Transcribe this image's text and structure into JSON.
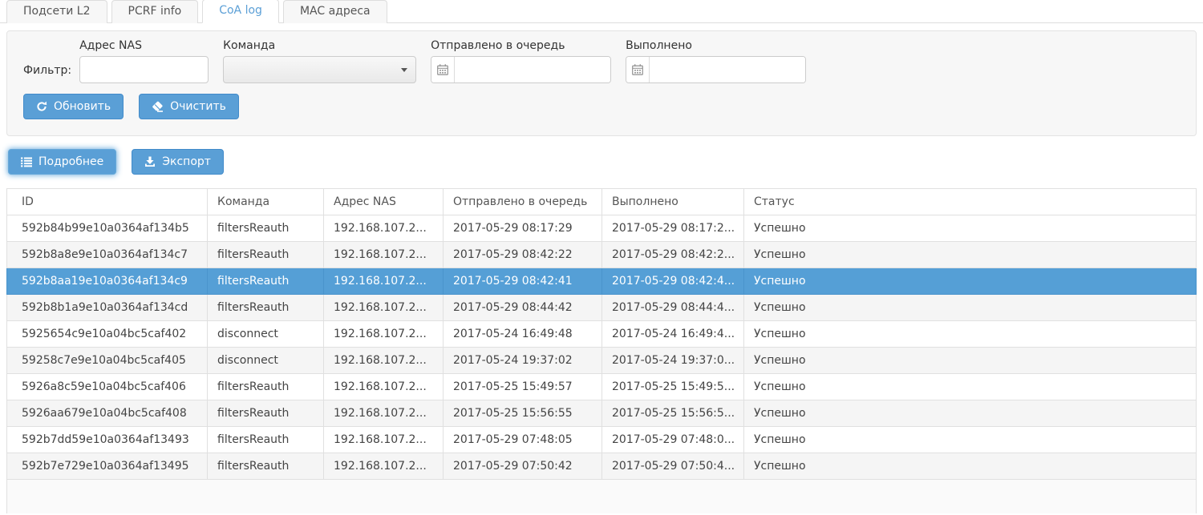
{
  "tabs": [
    {
      "label": "Подсети L2",
      "active": false
    },
    {
      "label": "PCRF info",
      "active": false
    },
    {
      "label": "CoA log",
      "active": true
    },
    {
      "label": "MAC адреса",
      "active": false
    }
  ],
  "filter": {
    "legend": "Фильтр:",
    "nas_label": "Адрес NAS",
    "nas_value": "",
    "command_label": "Команда",
    "command_value": "",
    "queued_label": "Отправлено в очередь",
    "queued_value": "",
    "done_label": "Выполнено",
    "done_value": ""
  },
  "buttons": {
    "refresh": "Обновить",
    "clear": "Очистить",
    "details": "Подробнее",
    "export": "Экспорт"
  },
  "table": {
    "columns": [
      "ID",
      "Команда",
      "Адрес NAS",
      "Отправлено в очередь",
      "Выполнено",
      "Статус"
    ],
    "selected_row_index": 2,
    "rows": [
      [
        "592b84b99e10a0364af134b5",
        "filtersReauth",
        "192.168.107.2...",
        "2017-05-29 08:17:29",
        "2017-05-29 08:17:2...",
        "Успешно"
      ],
      [
        "592b8a8e9e10a0364af134c7",
        "filtersReauth",
        "192.168.107.2...",
        "2017-05-29 08:42:22",
        "2017-05-29 08:42:2...",
        "Успешно"
      ],
      [
        "592b8aa19e10a0364af134c9",
        "filtersReauth",
        "192.168.107.2...",
        "2017-05-29 08:42:41",
        "2017-05-29 08:42:4...",
        "Успешно"
      ],
      [
        "592b8b1a9e10a0364af134cd",
        "filtersReauth",
        "192.168.107.2...",
        "2017-05-29 08:44:42",
        "2017-05-29 08:44:4...",
        "Успешно"
      ],
      [
        "5925654c9e10a04bc5caf402",
        "disconnect",
        "192.168.107.2...",
        "2017-05-24 16:49:48",
        "2017-05-24 16:49:4...",
        "Успешно"
      ],
      [
        "59258c7e9e10a04bc5caf405",
        "disconnect",
        "192.168.107.2...",
        "2017-05-24 19:37:02",
        "2017-05-24 19:37:0...",
        "Успешно"
      ],
      [
        "5926a8c59e10a04bc5caf406",
        "filtersReauth",
        "192.168.107.2...",
        "2017-05-25 15:49:57",
        "2017-05-25 15:49:5...",
        "Успешно"
      ],
      [
        "5926aa679e10a04bc5caf408",
        "filtersReauth",
        "192.168.107.2...",
        "2017-05-25 15:56:55",
        "2017-05-25 15:56:5...",
        "Успешно"
      ],
      [
        "592b7dd59e10a0364af13493",
        "filtersReauth",
        "192.168.107.2...",
        "2017-05-29 07:48:05",
        "2017-05-29 07:48:0...",
        "Успешно"
      ],
      [
        "592b7e729e10a0364af13495",
        "filtersReauth",
        "192.168.107.2...",
        "2017-05-29 07:50:42",
        "2017-05-29 07:50:4...",
        "Успешно"
      ]
    ]
  },
  "colors": {
    "accent": "#559fd6",
    "button_border": "#428bca",
    "selected_row_bg": "#559fd6",
    "panel_bg": "#f7f7f7",
    "stripe": "#f5f5f5",
    "table_border": "#e0e0e0"
  }
}
